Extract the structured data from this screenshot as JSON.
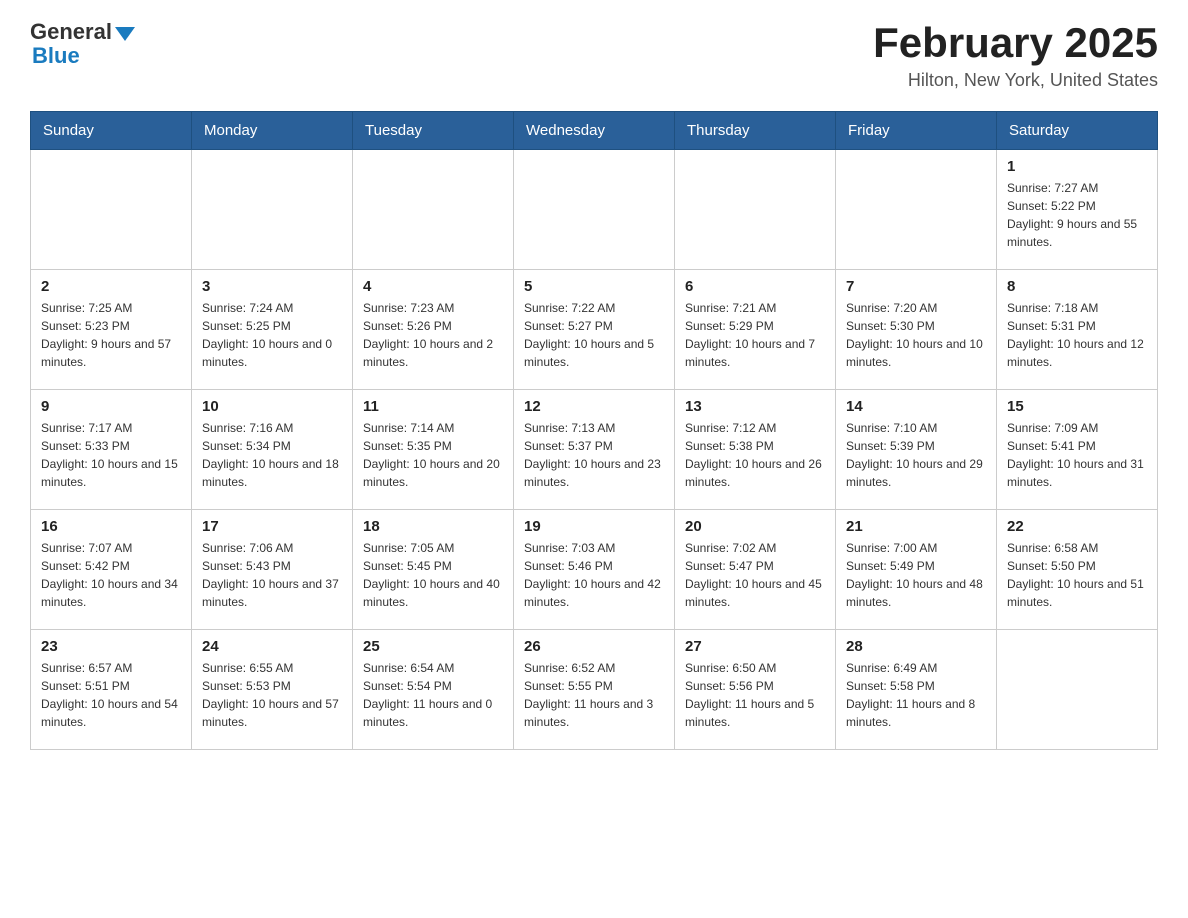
{
  "header": {
    "logo_general": "General",
    "logo_blue": "Blue",
    "month_year": "February 2025",
    "location": "Hilton, New York, United States"
  },
  "days_of_week": [
    "Sunday",
    "Monday",
    "Tuesday",
    "Wednesday",
    "Thursday",
    "Friday",
    "Saturday"
  ],
  "weeks": [
    [
      {
        "day": "",
        "sunrise": "",
        "sunset": "",
        "daylight": ""
      },
      {
        "day": "",
        "sunrise": "",
        "sunset": "",
        "daylight": ""
      },
      {
        "day": "",
        "sunrise": "",
        "sunset": "",
        "daylight": ""
      },
      {
        "day": "",
        "sunrise": "",
        "sunset": "",
        "daylight": ""
      },
      {
        "day": "",
        "sunrise": "",
        "sunset": "",
        "daylight": ""
      },
      {
        "day": "",
        "sunrise": "",
        "sunset": "",
        "daylight": ""
      },
      {
        "day": "1",
        "sunrise": "Sunrise: 7:27 AM",
        "sunset": "Sunset: 5:22 PM",
        "daylight": "Daylight: 9 hours and 55 minutes."
      }
    ],
    [
      {
        "day": "2",
        "sunrise": "Sunrise: 7:25 AM",
        "sunset": "Sunset: 5:23 PM",
        "daylight": "Daylight: 9 hours and 57 minutes."
      },
      {
        "day": "3",
        "sunrise": "Sunrise: 7:24 AM",
        "sunset": "Sunset: 5:25 PM",
        "daylight": "Daylight: 10 hours and 0 minutes."
      },
      {
        "day": "4",
        "sunrise": "Sunrise: 7:23 AM",
        "sunset": "Sunset: 5:26 PM",
        "daylight": "Daylight: 10 hours and 2 minutes."
      },
      {
        "day": "5",
        "sunrise": "Sunrise: 7:22 AM",
        "sunset": "Sunset: 5:27 PM",
        "daylight": "Daylight: 10 hours and 5 minutes."
      },
      {
        "day": "6",
        "sunrise": "Sunrise: 7:21 AM",
        "sunset": "Sunset: 5:29 PM",
        "daylight": "Daylight: 10 hours and 7 minutes."
      },
      {
        "day": "7",
        "sunrise": "Sunrise: 7:20 AM",
        "sunset": "Sunset: 5:30 PM",
        "daylight": "Daylight: 10 hours and 10 minutes."
      },
      {
        "day": "8",
        "sunrise": "Sunrise: 7:18 AM",
        "sunset": "Sunset: 5:31 PM",
        "daylight": "Daylight: 10 hours and 12 minutes."
      }
    ],
    [
      {
        "day": "9",
        "sunrise": "Sunrise: 7:17 AM",
        "sunset": "Sunset: 5:33 PM",
        "daylight": "Daylight: 10 hours and 15 minutes."
      },
      {
        "day": "10",
        "sunrise": "Sunrise: 7:16 AM",
        "sunset": "Sunset: 5:34 PM",
        "daylight": "Daylight: 10 hours and 18 minutes."
      },
      {
        "day": "11",
        "sunrise": "Sunrise: 7:14 AM",
        "sunset": "Sunset: 5:35 PM",
        "daylight": "Daylight: 10 hours and 20 minutes."
      },
      {
        "day": "12",
        "sunrise": "Sunrise: 7:13 AM",
        "sunset": "Sunset: 5:37 PM",
        "daylight": "Daylight: 10 hours and 23 minutes."
      },
      {
        "day": "13",
        "sunrise": "Sunrise: 7:12 AM",
        "sunset": "Sunset: 5:38 PM",
        "daylight": "Daylight: 10 hours and 26 minutes."
      },
      {
        "day": "14",
        "sunrise": "Sunrise: 7:10 AM",
        "sunset": "Sunset: 5:39 PM",
        "daylight": "Daylight: 10 hours and 29 minutes."
      },
      {
        "day": "15",
        "sunrise": "Sunrise: 7:09 AM",
        "sunset": "Sunset: 5:41 PM",
        "daylight": "Daylight: 10 hours and 31 minutes."
      }
    ],
    [
      {
        "day": "16",
        "sunrise": "Sunrise: 7:07 AM",
        "sunset": "Sunset: 5:42 PM",
        "daylight": "Daylight: 10 hours and 34 minutes."
      },
      {
        "day": "17",
        "sunrise": "Sunrise: 7:06 AM",
        "sunset": "Sunset: 5:43 PM",
        "daylight": "Daylight: 10 hours and 37 minutes."
      },
      {
        "day": "18",
        "sunrise": "Sunrise: 7:05 AM",
        "sunset": "Sunset: 5:45 PM",
        "daylight": "Daylight: 10 hours and 40 minutes."
      },
      {
        "day": "19",
        "sunrise": "Sunrise: 7:03 AM",
        "sunset": "Sunset: 5:46 PM",
        "daylight": "Daylight: 10 hours and 42 minutes."
      },
      {
        "day": "20",
        "sunrise": "Sunrise: 7:02 AM",
        "sunset": "Sunset: 5:47 PM",
        "daylight": "Daylight: 10 hours and 45 minutes."
      },
      {
        "day": "21",
        "sunrise": "Sunrise: 7:00 AM",
        "sunset": "Sunset: 5:49 PM",
        "daylight": "Daylight: 10 hours and 48 minutes."
      },
      {
        "day": "22",
        "sunrise": "Sunrise: 6:58 AM",
        "sunset": "Sunset: 5:50 PM",
        "daylight": "Daylight: 10 hours and 51 minutes."
      }
    ],
    [
      {
        "day": "23",
        "sunrise": "Sunrise: 6:57 AM",
        "sunset": "Sunset: 5:51 PM",
        "daylight": "Daylight: 10 hours and 54 minutes."
      },
      {
        "day": "24",
        "sunrise": "Sunrise: 6:55 AM",
        "sunset": "Sunset: 5:53 PM",
        "daylight": "Daylight: 10 hours and 57 minutes."
      },
      {
        "day": "25",
        "sunrise": "Sunrise: 6:54 AM",
        "sunset": "Sunset: 5:54 PM",
        "daylight": "Daylight: 11 hours and 0 minutes."
      },
      {
        "day": "26",
        "sunrise": "Sunrise: 6:52 AM",
        "sunset": "Sunset: 5:55 PM",
        "daylight": "Daylight: 11 hours and 3 minutes."
      },
      {
        "day": "27",
        "sunrise": "Sunrise: 6:50 AM",
        "sunset": "Sunset: 5:56 PM",
        "daylight": "Daylight: 11 hours and 5 minutes."
      },
      {
        "day": "28",
        "sunrise": "Sunrise: 6:49 AM",
        "sunset": "Sunset: 5:58 PM",
        "daylight": "Daylight: 11 hours and 8 minutes."
      },
      {
        "day": "",
        "sunrise": "",
        "sunset": "",
        "daylight": ""
      }
    ]
  ]
}
